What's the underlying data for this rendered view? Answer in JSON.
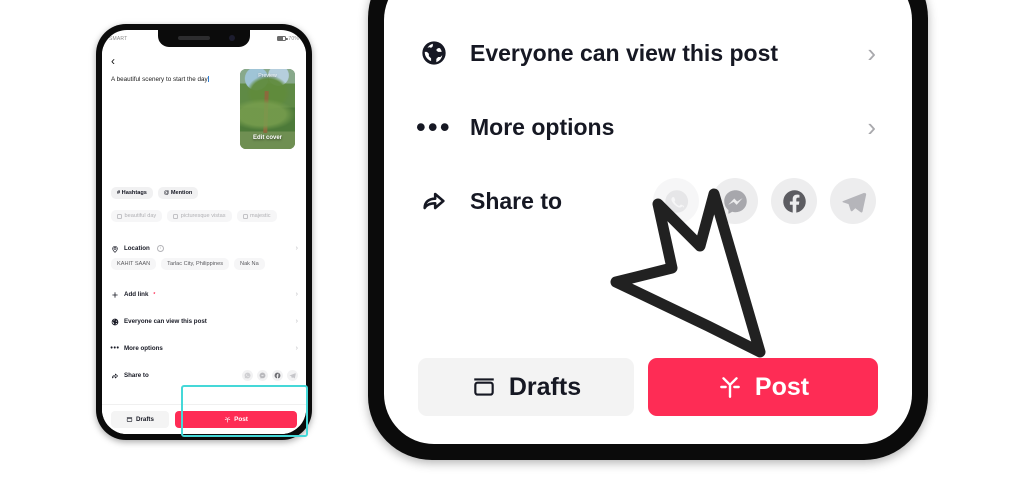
{
  "left_phone": {
    "status_bar": {
      "carrier": "SMART",
      "battery": "70%"
    },
    "back_icon": "‹",
    "caption": "A beautiful scenery to start the day",
    "thumbnail": {
      "preview_label": "Preview",
      "edit_cover_label": "Edit cover"
    },
    "tag_chips": [
      {
        "label": "# Hashtags"
      },
      {
        "label": "@ Mention"
      }
    ],
    "suggestion_chips": [
      {
        "label": "beautiful day"
      },
      {
        "label": "picturesque vistas"
      },
      {
        "label": "majestic"
      }
    ],
    "location": {
      "label": "Location",
      "chips": [
        "KAHIT SAAN",
        "Tarlac City, Philippines",
        "Nak Na"
      ]
    },
    "rows": [
      {
        "label": "Add link",
        "icon": "plus-icon",
        "required": true
      },
      {
        "label": "Everyone can view this post",
        "icon": "globe-icon"
      },
      {
        "label": "More options",
        "icon": "ellipsis-icon"
      },
      {
        "label": "Share to",
        "icon": "share-arrow-icon"
      }
    ],
    "share_targets": [
      "whatsapp-icon",
      "messenger-icon",
      "facebook-icon",
      "telegram-icon"
    ],
    "buttons": {
      "drafts": "Drafts",
      "post": "Post"
    }
  },
  "right_phone": {
    "rows": [
      {
        "label": "Everyone can view this post",
        "icon": "globe-icon"
      },
      {
        "label": "More options",
        "icon": "ellipsis-icon"
      },
      {
        "label": "Share to",
        "icon": "share-arrow-icon"
      }
    ],
    "share_targets": [
      "whatsapp-icon",
      "messenger-icon",
      "facebook-icon",
      "telegram-icon"
    ],
    "buttons": {
      "drafts": "Drafts",
      "post": "Post"
    }
  },
  "annotation": {
    "highlight_color": "#45d8d8",
    "cursor": "arrow-cursor",
    "target": "post-button"
  },
  "colors": {
    "accent_pink": "#fe2c55",
    "highlight_cyan": "#45d8d8",
    "chip_gray": "#f1f1f2",
    "text_dark": "#161823"
  }
}
